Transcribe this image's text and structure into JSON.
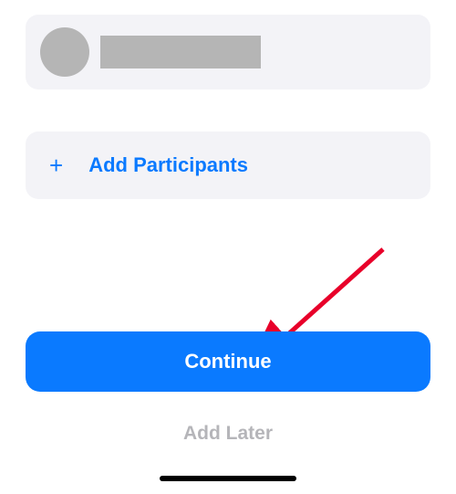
{
  "participant": {
    "avatar_label": "participant avatar",
    "name_label": "participant name"
  },
  "add_participants": {
    "icon": "+",
    "label": "Add Participants"
  },
  "buttons": {
    "continue": "Continue",
    "add_later": "Add Later"
  },
  "annotation": {
    "arrow_color": "#e8002a"
  }
}
